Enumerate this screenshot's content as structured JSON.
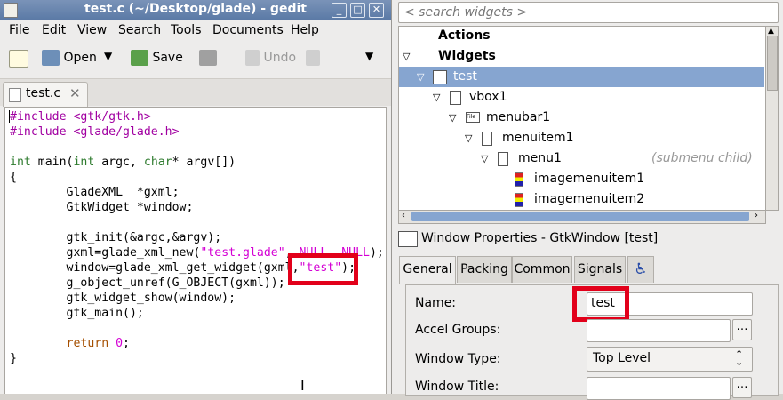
{
  "gedit": {
    "title": "test.c (~/Desktop/glade) - gedit",
    "menu": [
      "File",
      "Edit",
      "View",
      "Search",
      "Tools",
      "Documents",
      "Help"
    ],
    "toolbar": {
      "open": "Open",
      "save": "Save",
      "undo": "Undo"
    },
    "tab": "test.c",
    "code": {
      "l1": "#include <gtk/gtk.h>",
      "l2": "#include <glade/glade.h>",
      "l4_kw1": "int",
      "l4_mid": " main(",
      "l4_kw2": "int",
      "l4_mid2": " argc, ",
      "l4_kw3": "char",
      "l4_end": "* argv[])",
      "l5": "{",
      "l6": "        GladeXML  *gxml;",
      "l7": "        GtkWidget *window;",
      "l9": "        gtk_init(&argc,&argv);",
      "l10_a": "        gxml=glade_xml_new(",
      "l10_s1": "\"test.glade\"",
      "l10_b": ", ",
      "l10_n1": "NULL",
      "l10_c": ", ",
      "l10_n2": "NULL",
      "l10_d": ");",
      "l11_a": "        window=glade_xml_get_widget(gxml,",
      "l11_s": "\"test\"",
      "l11_b": ");",
      "l12": "        g_object_unref(G_OBJECT(gxml));",
      "l13": "        gtk_widget_show(window);",
      "l14": "        gtk_main();",
      "l16_kw": "        return",
      "l16_n": " 0",
      "l16_e": ";",
      "l17": "}"
    }
  },
  "glade": {
    "search_placeholder": "< search widgets >",
    "tree": {
      "actions": "Actions",
      "widgets": "Widgets",
      "test": "test",
      "vbox1": "vbox1",
      "menubar1": "menubar1",
      "menuitem1": "menuitem1",
      "menu1": "menu1",
      "menu1_hint": "(submenu child)",
      "imagemenuitem1": "imagemenuitem1",
      "imagemenuitem2": "imagemenuitem2"
    },
    "prop_header": "Window Properties - GtkWindow [test]",
    "tabs": [
      "General",
      "Packing",
      "Common",
      "Signals"
    ],
    "props": {
      "name_label": "Name:",
      "name_value": "test",
      "accel_label": "Accel Groups:",
      "type_label": "Window Type:",
      "type_value": "Top Level",
      "title_label": "Window Title:"
    }
  },
  "colors": {
    "highlight": "#e2001a",
    "selection": "#86a5d0",
    "string": "#d400d4"
  }
}
